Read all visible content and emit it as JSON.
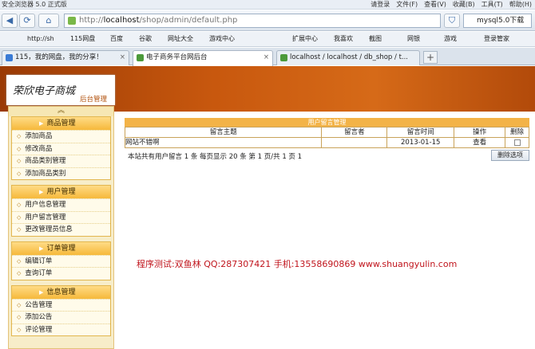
{
  "browser": {
    "title_text": "安全浏览器 5.0 正式版",
    "login_label": "请登录",
    "menus": [
      "文件(F)",
      "查看(V)",
      "收藏(B)",
      "工具(T)",
      "帮助(H)"
    ],
    "address_prefix": "http://",
    "address_host": "localhost",
    "address_path": "/shop/admin/default.php",
    "search_text": "mysql5.0下载",
    "bookmarks": [
      "http://sh",
      "115网盘",
      "百度",
      "谷歌",
      "网址大全",
      "游戏中心",
      "扩展中心",
      "我喜欢",
      "截图",
      "网银",
      "游戏",
      "登录管家"
    ],
    "tabs": [
      {
        "label": "115，我的网盘，我的分享！"
      },
      {
        "label": "电子商务平台网后台"
      },
      {
        "label": "localhost / localhost / db_shop / t..."
      }
    ],
    "new_tab_label": "+"
  },
  "header": {
    "site_name": "荣欣电子商城",
    "site_sub": "后台管理"
  },
  "sidebar": {
    "collapse_label": "︽",
    "groups": [
      {
        "title": "商品管理",
        "items": [
          "添加商品",
          "修改商品",
          "商品类别管理",
          "添加商品类别"
        ]
      },
      {
        "title": "用户管理",
        "items": [
          "用户信息管理",
          "用户留言管理",
          "更改管理员信息"
        ]
      },
      {
        "title": "订单管理",
        "items": [
          "编辑订单",
          "查询订单"
        ]
      },
      {
        "title": "信息管理",
        "items": [
          "公告管理",
          "添加公告",
          "评论管理"
        ]
      }
    ]
  },
  "main": {
    "caption": "用户留言管理",
    "columns": [
      "留言主题",
      "留言者",
      "留言时间",
      "操作",
      "删除"
    ],
    "rows": [
      {
        "subject": "网站不错啊",
        "author": "",
        "date": "2013-01-15",
        "action": "查看"
      }
    ],
    "summary": "本站共有用户留言 1 条 每页显示 20 条 第 1 页/共 1 页 1",
    "delete_button": "删除选项",
    "watermark": "程序测试:双鱼林 QQ:287307421 手机:13558690869 www.shuangyulin.com"
  }
}
